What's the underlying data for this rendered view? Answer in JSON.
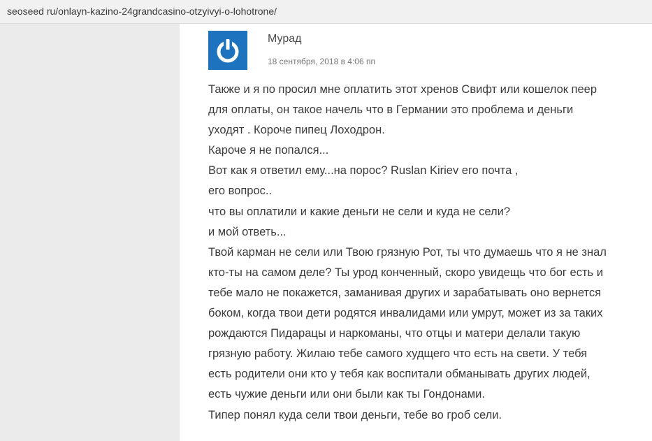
{
  "browser": {
    "url": "seoseed ru/onlayn-kazino-24grandcasino-otzyivyi-o-lohotrone/"
  },
  "comment": {
    "avatar_icon": "power-icon",
    "avatar_color": "#1e73be",
    "author": "Мурад",
    "date": "18 сентября, 2018 в 4:06 пп",
    "lines": [
      "Также и я по просил мне оплатить этот хренов Свифт или кошелок пеер",
      "для оплаты, он такое начель что в Германии это проблема и деньги",
      "уходят . Короче пипец Лоходрон.",
      "Кароче я не попался...",
      "Вот как я ответил ему...на порос? Ruslan Kiriev его почта ,",
      " его вопрос..",
      "что вы оплатили и какие деньги не сели и куда не сели?",
      "и мой ответь...",
      "Твой карман не сели или Твою грязную Рот, ты что думаешь что я не знал",
      "кто-ты на самом деле? Ты урод конченный, скоро увидещь что бог есть и",
      "тебе мало не покажется, заманивая других и зарабатывать оно вернется",
      "боком, когда твои дети родятся инвалидами или умрут, может из за таких",
      "рождаются Пидарацы и наркоманы, что отцы и матери делали такую",
      "грязную работу. Жилаю тебе самого худщего что есть на свети. У тебя",
      "есть родители они кто у тебя как воспитали обманывать других людей,",
      "есть чужие деньги или они были как ты Гондонами.",
      "Типер понял куда сели твои деньги, тебе во гроб сели."
    ]
  }
}
